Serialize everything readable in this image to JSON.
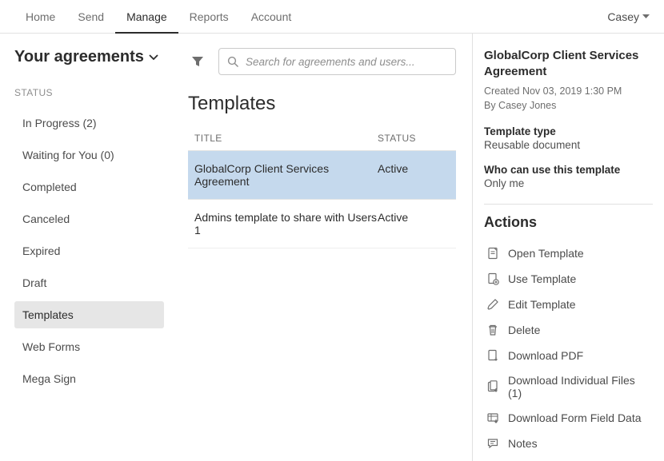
{
  "topnav": {
    "items": [
      "Home",
      "Send",
      "Manage",
      "Reports",
      "Account"
    ],
    "active_index": 2,
    "user": "Casey"
  },
  "sidebar": {
    "title": "Your agreements",
    "section_label": "Status",
    "items": [
      {
        "label": "In Progress (2)"
      },
      {
        "label": "Waiting for You (0)"
      },
      {
        "label": "Completed"
      },
      {
        "label": "Canceled"
      },
      {
        "label": "Expired"
      },
      {
        "label": "Draft"
      },
      {
        "label": "Templates",
        "active": true
      },
      {
        "label": "Web Forms"
      },
      {
        "label": "Mega Sign"
      }
    ]
  },
  "search": {
    "placeholder": "Search for agreements and users..."
  },
  "main": {
    "heading": "Templates",
    "columns": {
      "title": "Title",
      "status": "Status"
    },
    "rows": [
      {
        "title": "GlobalCorp Client Services Agreement",
        "status": "Active",
        "selected": true
      },
      {
        "title": "Admins template to share with Users 1",
        "status": "Active",
        "selected": false
      }
    ]
  },
  "details": {
    "title": "GlobalCorp Client Services Agreement",
    "created_line": "Created Nov 03, 2019 1:30 PM",
    "by_line": "By Casey Jones",
    "template_type_label": "Template type",
    "template_type_value": "Reusable document",
    "who_label": "Who can use this template",
    "who_value": "Only me",
    "actions_heading": "Actions",
    "actions": [
      {
        "icon": "open-template-icon",
        "label": "Open Template"
      },
      {
        "icon": "use-template-icon",
        "label": "Use Template"
      },
      {
        "icon": "edit-template-icon",
        "label": "Edit Template"
      },
      {
        "icon": "delete-icon",
        "label": "Delete"
      },
      {
        "icon": "download-pdf-icon",
        "label": "Download PDF"
      },
      {
        "icon": "download-files-icon",
        "label": "Download Individual Files (1)"
      },
      {
        "icon": "download-form-data-icon",
        "label": "Download Form Field Data"
      },
      {
        "icon": "notes-icon",
        "label": "Notes"
      }
    ]
  }
}
